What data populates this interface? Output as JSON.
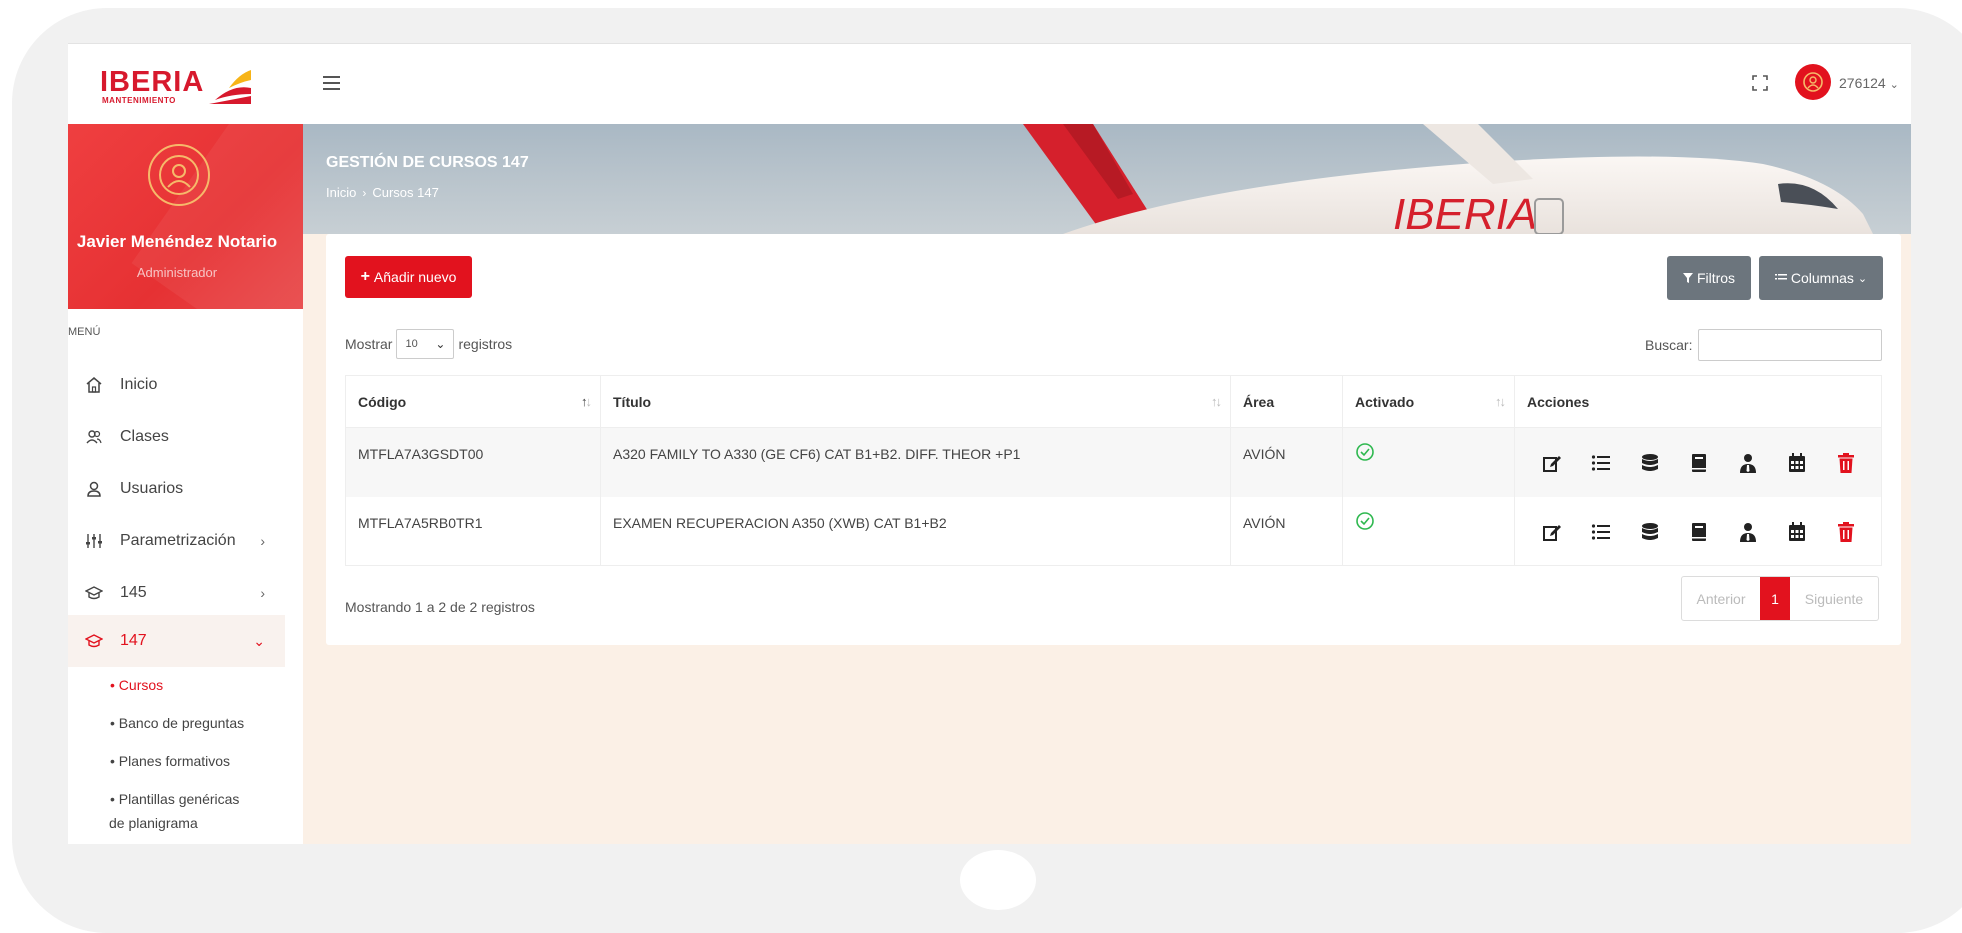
{
  "header": {
    "logo_text": "IBERIA",
    "logo_subtext": "MANTENIMIENTO",
    "user_code": "276124",
    "accent": "#e2121e"
  },
  "sidebar": {
    "profile_name": "Javier Menéndez Notario",
    "profile_role": "Administrador",
    "menu_title": "MENÚ",
    "items": [
      {
        "label": "Inicio",
        "icon": "home-icon"
      },
      {
        "label": "Clases",
        "icon": "users-icon"
      },
      {
        "label": "Usuarios",
        "icon": "user-icon"
      },
      {
        "label": "Parametrización",
        "icon": "sliders-icon",
        "arrow": "›"
      },
      {
        "label": "145",
        "icon": "graduation-cap-icon",
        "arrow": "›"
      },
      {
        "label": "147",
        "icon": "graduation-cap-icon",
        "arrow": "⌄"
      }
    ],
    "subitems": [
      "• Cursos",
      "• Banco de preguntas",
      "• Planes formativos",
      "• Plantillas genéricas",
      "de planigrama"
    ]
  },
  "banner": {
    "title": "GESTIÓN DE CURSOS 147",
    "breadcrumb_home": "Inicio",
    "breadcrumb_current": "Cursos 147",
    "plane_livery": "IBERIA"
  },
  "toolbar": {
    "add_label": "Añadir nuevo",
    "filters_label": "Filtros",
    "columns_label": "Columnas"
  },
  "table_controls": {
    "show_label": "Mostrar",
    "page_size": "10",
    "records_label": "registros",
    "search_label": "Buscar:"
  },
  "table": {
    "headers": [
      "Código",
      "Título",
      "Área",
      "Activado",
      "Acciones"
    ],
    "rows": [
      {
        "code": "MTFLA7A3GSDT00",
        "title": "A320 FAMILY TO A330 (GE CF6) CAT B1+B2. DIFF. THEOR +P1",
        "area": "AVIÓN",
        "active": true
      },
      {
        "code": "MTFLA7A5RB0TR1",
        "title": "EXAMEN RECUPERACION A350 (XWB) CAT B1+B2",
        "area": "AVIÓN",
        "active": true
      }
    ],
    "action_icons": [
      "edit-icon",
      "list-icon",
      "database-icon",
      "book-icon",
      "user-tie-icon",
      "calendar-icon",
      "trash-icon"
    ]
  },
  "footer": {
    "info": "Mostrando 1 a 2 de 2 registros",
    "prev": "Anterior",
    "page": "1",
    "next": "Siguiente"
  }
}
